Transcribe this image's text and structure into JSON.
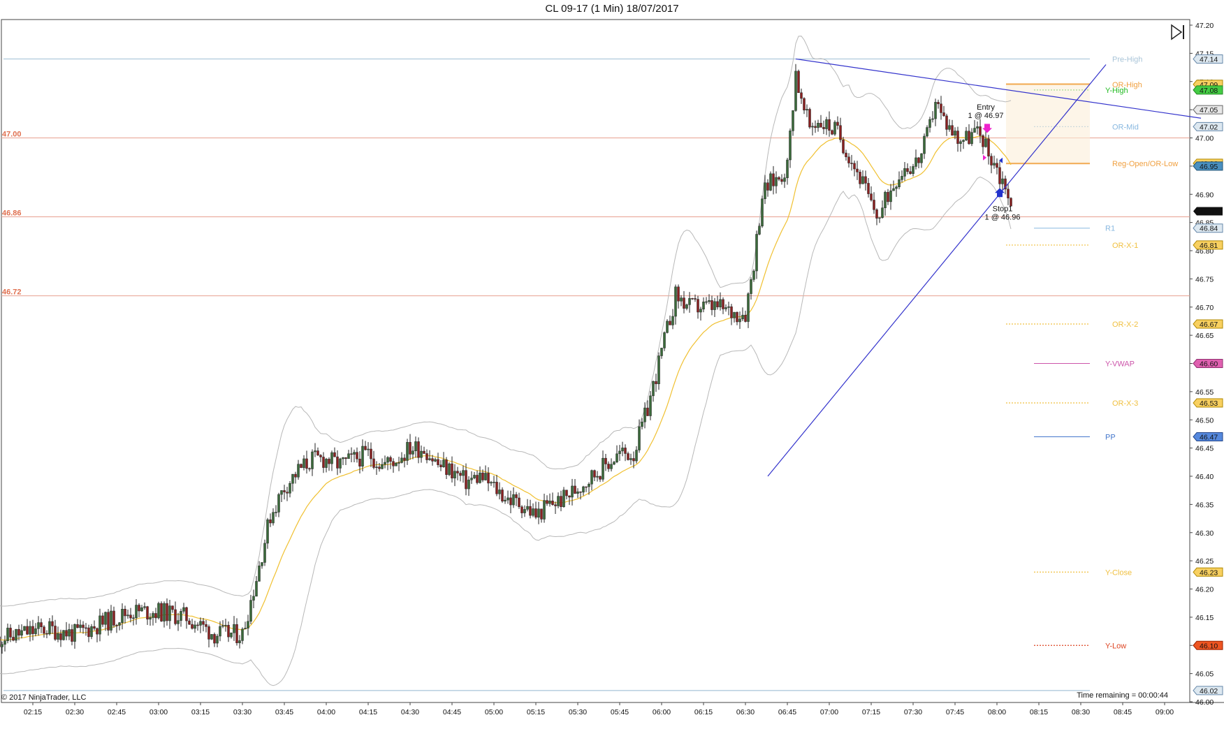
{
  "title": "CL 09-17 (1 Min)  18/07/2017",
  "copyright": "© 2017 NinjaTrader, LLC",
  "time_remaining": "Time remaining = 00:00:44",
  "chart_data": {
    "type": "candlestick",
    "instrument": "CL 09-17",
    "interval": "1 Min",
    "date": "18/07/2017",
    "ylim": [
      46.0,
      47.2
    ],
    "y_ticks": [
      "47.20",
      "47.15",
      "47.10",
      "47.05",
      "47.00",
      "46.95",
      "46.90",
      "46.85",
      "46.80",
      "46.75",
      "46.70",
      "46.65",
      "46.60",
      "46.55",
      "46.50",
      "46.45",
      "46.40",
      "46.35",
      "46.30",
      "46.25",
      "46.20",
      "46.15",
      "46.10",
      "46.05",
      "46.00"
    ],
    "x_ticks": [
      "02:15",
      "02:30",
      "02:45",
      "03:00",
      "03:15",
      "03:30",
      "03:45",
      "04:00",
      "04:15",
      "04:30",
      "04:45",
      "05:00",
      "05:15",
      "05:30",
      "05:45",
      "06:00",
      "06:15",
      "06:30",
      "06:45",
      "07:00",
      "07:15",
      "07:30",
      "07:45",
      "08:00",
      "08:15",
      "08:30",
      "08:45",
      "09:00"
    ],
    "x_range_minutes": [
      122,
      555
    ],
    "grid": false,
    "close_path": [
      [
        122,
        46.11
      ],
      [
        130,
        46.12
      ],
      [
        140,
        46.13
      ],
      [
        150,
        46.12
      ],
      [
        160,
        46.14
      ],
      [
        170,
        46.16
      ],
      [
        180,
        46.16
      ],
      [
        190,
        46.15
      ],
      [
        200,
        46.12
      ],
      [
        210,
        46.12
      ],
      [
        215,
        46.22
      ],
      [
        220,
        46.33
      ],
      [
        225,
        46.38
      ],
      [
        230,
        46.41
      ],
      [
        235,
        46.43
      ],
      [
        240,
        46.43
      ],
      [
        245,
        46.42
      ],
      [
        250,
        46.43
      ],
      [
        255,
        46.44
      ],
      [
        260,
        46.42
      ],
      [
        265,
        46.43
      ],
      [
        270,
        46.45
      ],
      [
        275,
        46.45
      ],
      [
        280,
        46.42
      ],
      [
        285,
        46.41
      ],
      [
        290,
        46.39
      ],
      [
        295,
        46.4
      ],
      [
        300,
        46.38
      ],
      [
        305,
        46.36
      ],
      [
        310,
        46.35
      ],
      [
        315,
        46.33
      ],
      [
        320,
        46.35
      ],
      [
        325,
        46.36
      ],
      [
        330,
        46.38
      ],
      [
        335,
        46.4
      ],
      [
        340,
        46.42
      ],
      [
        345,
        46.44
      ],
      [
        350,
        46.44
      ],
      [
        355,
        46.52
      ],
      [
        360,
        46.62
      ],
      [
        365,
        46.72
      ],
      [
        370,
        46.7
      ],
      [
        375,
        46.7
      ],
      [
        380,
        46.7
      ],
      [
        385,
        46.69
      ],
      [
        390,
        46.69
      ],
      [
        393,
        46.78
      ],
      [
        396,
        46.9
      ],
      [
        399,
        46.92
      ],
      [
        402,
        46.93
      ],
      [
        405,
        46.95
      ],
      [
        408,
        47.12
      ],
      [
        410,
        47.06
      ],
      [
        413,
        47.02
      ],
      [
        416,
        47.03
      ],
      [
        420,
        47.02
      ],
      [
        423,
        47.01
      ],
      [
        426,
        46.98
      ],
      [
        429,
        46.95
      ],
      [
        432,
        46.92
      ],
      [
        435,
        46.88
      ],
      [
        438,
        46.86
      ],
      [
        441,
        46.9
      ],
      [
        444,
        46.93
      ],
      [
        447,
        46.95
      ],
      [
        450,
        46.95
      ],
      [
        453,
        46.97
      ],
      [
        456,
        47.02
      ],
      [
        458,
        47.07
      ],
      [
        460,
        47.04
      ],
      [
        463,
        47.02
      ],
      [
        466,
        47.0
      ],
      [
        469,
        47.0
      ],
      [
        472,
        47.01
      ],
      [
        475,
        47.0
      ],
      [
        477,
        46.97
      ],
      [
        479,
        46.96
      ],
      [
        481,
        46.93
      ],
      [
        483,
        46.92
      ],
      [
        485,
        46.87
      ]
    ],
    "ohlc_overlays": {
      "ema": "yellow",
      "bands": "gray"
    },
    "current_price": "46.87",
    "levels": [
      {
        "label": "Pre-High",
        "value": 47.14,
        "price_tag": "47.14",
        "color": "#a8c4d8",
        "style": "solid"
      },
      {
        "label": "OR-High",
        "value": 47.095,
        "price_tag": "47.09",
        "color": "#f0a040",
        "style": "solid"
      },
      {
        "label": "Y-High",
        "value": 47.085,
        "price_tag": "47.08",
        "color": "#22bb22",
        "style": "dotted"
      },
      {
        "label": "",
        "value": 47.05,
        "price_tag": "47.05",
        "color": "#888888",
        "style": "none"
      },
      {
        "label": "OR-Mid",
        "value": 47.02,
        "price_tag": "47.02",
        "color": "#88b8e0",
        "style": "dotted"
      },
      {
        "label": "Reg-Open/OR-Low",
        "value": 46.955,
        "price_tag": "46.96",
        "color": "#f0a040",
        "style": "solid"
      },
      {
        "label": "",
        "value": 46.95,
        "price_tag": "46.95",
        "color": "#4a90c0",
        "style": "none"
      },
      {
        "label": "R1",
        "value": 46.84,
        "price_tag": "46.84",
        "color": "#88b8e0",
        "style": "solid"
      },
      {
        "label": "OR-X-1",
        "value": 46.81,
        "price_tag": "46.81",
        "color": "#f0c040",
        "style": "dotted"
      },
      {
        "label": "OR-X-2",
        "value": 46.67,
        "price_tag": "46.67",
        "color": "#f0c040",
        "style": "dotted"
      },
      {
        "label": "Y-VWAP",
        "value": 46.6,
        "price_tag": "46.60",
        "color": "#cc55aa",
        "style": "solid"
      },
      {
        "label": "OR-X-3",
        "value": 46.53,
        "price_tag": "46.53",
        "color": "#f0c040",
        "style": "dotted"
      },
      {
        "label": "PP",
        "value": 46.47,
        "price_tag": "46.47",
        "color": "#4477cc",
        "style": "solid"
      },
      {
        "label": "Y-Close",
        "value": 46.23,
        "price_tag": "46.23",
        "color": "#f0c040",
        "style": "dotted"
      },
      {
        "label": "Y-Low",
        "value": 46.1,
        "price_tag": "46.10",
        "color": "#dd4422",
        "style": "dotted"
      },
      {
        "label": "",
        "value": 46.02,
        "price_tag": "46.02",
        "color": "#a8c4d8",
        "style": "solid"
      }
    ],
    "horizontal_lines": [
      {
        "label": "47.00",
        "value": 47.0,
        "color": "#e8a090"
      },
      {
        "label": "46.86",
        "value": 46.86,
        "color": "#e8a090"
      },
      {
        "label": "46.72",
        "value": 46.72,
        "color": "#e8a090"
      }
    ],
    "trendlines": [
      {
        "from": [
          408,
          47.14
        ],
        "to": [
          553,
          47.035
        ],
        "color": "#3333cc"
      },
      {
        "from": [
          398,
          46.4
        ],
        "to": [
          519,
          47.13
        ],
        "color": "#3333cc"
      }
    ],
    "annotations": [
      {
        "text": "Entry",
        "x": 476,
        "y": 47.05
      },
      {
        "text": "1 @ 46.97",
        "x": 476,
        "y": 47.035
      },
      {
        "text": "Stop1",
        "x": 482,
        "y": 46.87
      },
      {
        "text": "1 @ 46.96",
        "x": 482,
        "y": 46.855
      }
    ]
  }
}
